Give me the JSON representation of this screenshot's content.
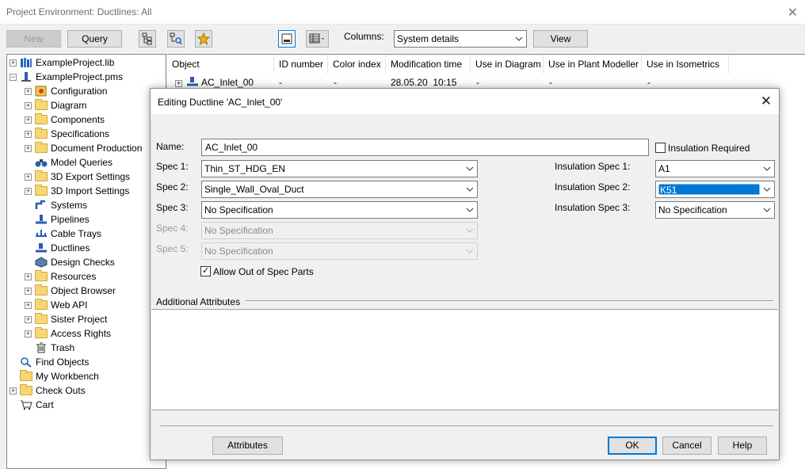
{
  "window": {
    "title": "Project Environment: Ductlines: All"
  },
  "toolbar": {
    "new_label": "New",
    "query_label": "Query",
    "columns_label": "Columns:",
    "columns_value": "System details",
    "view_label": "View"
  },
  "tree": {
    "root1": "ExampleProject.lib",
    "root2": "ExampleProject.pms",
    "items": [
      "Configuration",
      "Diagram",
      "Components",
      "Specifications",
      "Document Production",
      "Model Queries",
      "3D Export Settings",
      "3D Import Settings",
      "Systems",
      "Pipelines",
      "Cable Trays",
      "Ductlines",
      "Design Checks",
      "Resources",
      "Object Browser",
      "Web API",
      "Sister Project",
      "Access Rights",
      "Trash"
    ],
    "bottom": [
      "Find Objects",
      "My Workbench",
      "Check Outs",
      "Cart"
    ]
  },
  "list": {
    "headers": [
      "Object",
      "ID number",
      "Color index",
      "Modification time",
      "Use in Diagram",
      "Use in Plant Modeller",
      "Use in Isometrics"
    ],
    "row": [
      "AC_Inlet_00",
      "-",
      "-",
      "28.05.20  10:15",
      "-",
      "-",
      "-"
    ]
  },
  "dialog": {
    "title": "Editing Ductline 'AC_Inlet_00'",
    "name_label": "Name:",
    "name_value": "AC_Inlet_00",
    "insulation_required": "Insulation Required",
    "spec1_label": "Spec 1:",
    "spec1_value": "Thin_ST_HDG_EN",
    "spec2_label": "Spec 2:",
    "spec2_value": "Single_Wall_Oval_Duct",
    "spec3_label": "Spec 3:",
    "spec3_value": "No Specification",
    "spec4_label": "Spec 4:",
    "spec4_value": "No Specification",
    "spec5_label": "Spec 5:",
    "spec5_value": "No Specification",
    "ins1_label": "Insulation Spec 1:",
    "ins1_value": "A1",
    "ins2_label": "Insulation Spec 2:",
    "ins2_value": "K51",
    "ins3_label": "Insulation Spec 3:",
    "ins3_value": "No Specification",
    "allow_label": "Allow Out of Spec Parts",
    "additional_label": "Additional Attributes",
    "attributes_btn": "Attributes",
    "ok_btn": "OK",
    "cancel_btn": "Cancel",
    "help_btn": "Help"
  },
  "colors": {
    "accent": "#0078d7",
    "folder": "#f7d774"
  }
}
